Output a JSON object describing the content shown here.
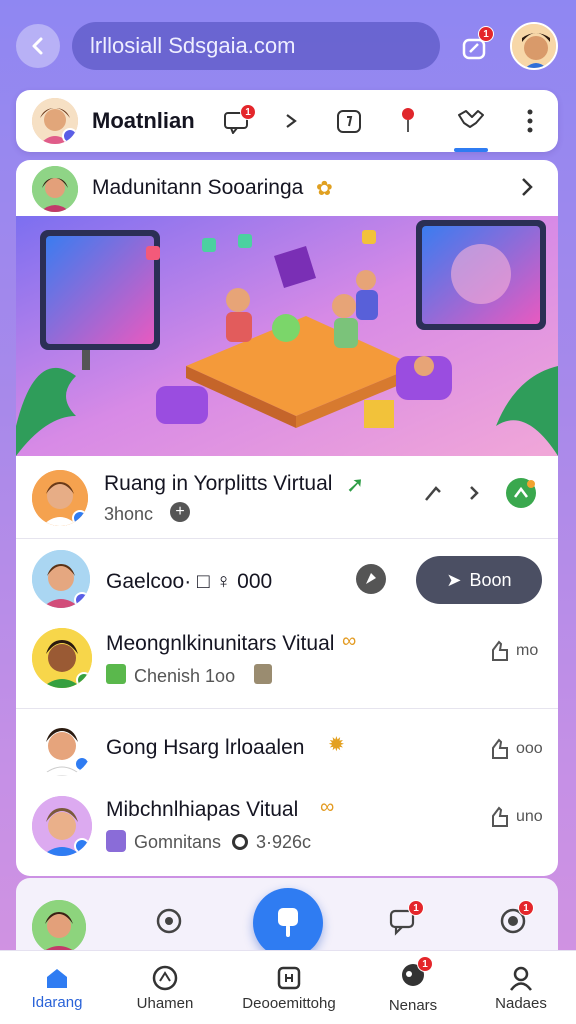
{
  "top_bar": {
    "url_text": "lrllosiall Sdsgaia.com",
    "notif_badge": "1"
  },
  "tab_card": {
    "title": "Moatnlian",
    "badge_count": "1"
  },
  "room_header": {
    "title": "Madunitann Sooaringa"
  },
  "rows": [
    {
      "title": "Ruang in Yorplitts Virtual",
      "subtitle": "3honc"
    },
    {
      "title": "Gaelcoo· □ ♀ 000",
      "button": "Boon"
    },
    {
      "title": "Meongnlkinunitars Vitual",
      "subtitle": "Chenish 1oo",
      "meta": "mo"
    },
    {
      "title": "Gong Hsarg lrloaalen",
      "meta": "ooo"
    },
    {
      "title": "Mibchnlhiapas Vitual",
      "subtitle": "Gomnitans",
      "stat": "3·926c",
      "meta": "uno"
    }
  ],
  "bottom_badges": [
    "1",
    "1"
  ],
  "nav": {
    "items": [
      {
        "label": "Idarang",
        "active": true
      },
      {
        "label": "Uhamen",
        "active": false
      },
      {
        "label": "Deooemittohg",
        "active": false
      },
      {
        "label": "Nenars",
        "active": false,
        "badge": "1"
      },
      {
        "label": "Nadaes",
        "active": false
      }
    ]
  },
  "colors": {
    "accent": "#2f7cf2",
    "badge": "#e4262b",
    "nav_active": "#2a63d8"
  }
}
